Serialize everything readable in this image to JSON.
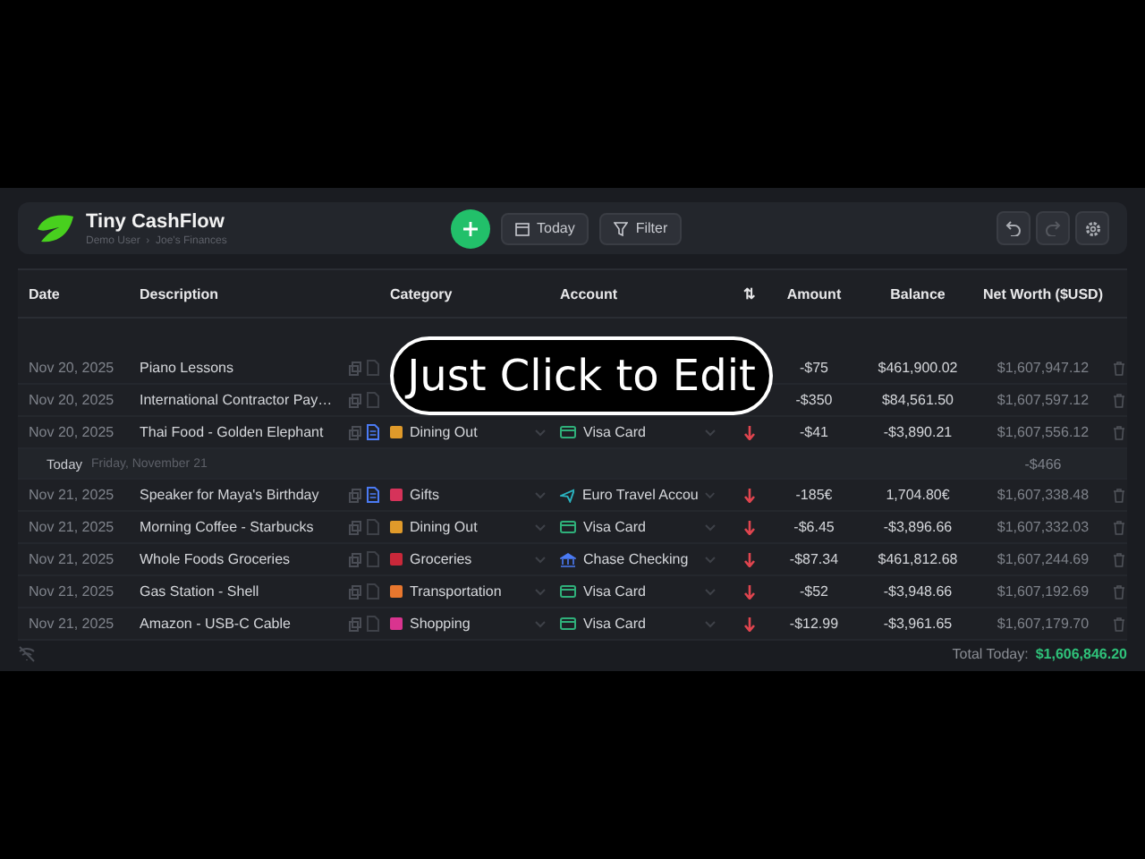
{
  "app": {
    "title": "Tiny CashFlow",
    "subtitle": "Demo User  ›  Joe's Finances"
  },
  "toolbar": {
    "buttons": [
      {
        "kind": "today",
        "label": "Today"
      },
      {
        "kind": "filter",
        "label": "Filter"
      }
    ]
  },
  "table": {
    "columns": [
      "Date",
      "Description",
      "Category",
      "Account",
      "⇅",
      "Amount",
      "Balance",
      "Net Worth ($USD)"
    ],
    "rows": [
      {
        "kind": "transaction",
        "date": "Nov 20, 2025",
        "description": "Piano Lessons",
        "has_note": false,
        "amount": "-$75",
        "balance": "$461,900.02",
        "net_worth": "$1,607,947.12"
      },
      {
        "kind": "transaction",
        "date": "Nov 20, 2025",
        "description": "International Contractor Pay…",
        "has_note": false,
        "amount": "-$350",
        "balance": "$84,561.50",
        "net_worth": "$1,607,597.12"
      },
      {
        "kind": "transaction",
        "date": "Nov 20, 2025",
        "description": "Thai Food - Golden Elephant",
        "has_note": true,
        "category": "Dining Out",
        "color": "#e09a2a",
        "account": {
          "kind": "card",
          "name": "Visa Card"
        },
        "amount": "-$41",
        "balance": "-$3,890.21",
        "net_worth": "$1,607,556.12"
      },
      {
        "kind": "group",
        "label": "Today",
        "date": "Friday, November 21",
        "total": "-$466"
      },
      {
        "kind": "transaction",
        "date": "Nov 21, 2025",
        "description": "Speaker for Maya's Birthday",
        "has_note": true,
        "category": "Gifts",
        "color": "#d6335a",
        "account": {
          "kind": "travel",
          "name": "Euro Travel Accou"
        },
        "amount": "-185€",
        "balance": "1,704.80€",
        "net_worth": "$1,607,338.48"
      },
      {
        "kind": "transaction",
        "date": "Nov 21, 2025",
        "description": "Morning Coffee - Starbucks",
        "has_note": false,
        "category": "Dining Out",
        "color": "#e09a2a",
        "account": {
          "kind": "card",
          "name": "Visa Card"
        },
        "amount": "-$6.45",
        "balance": "-$3,896.66",
        "net_worth": "$1,607,332.03"
      },
      {
        "kind": "transaction",
        "date": "Nov 21, 2025",
        "description": "Whole Foods Groceries",
        "has_note": false,
        "category": "Groceries",
        "color": "#c9283a",
        "account": {
          "kind": "bank",
          "name": "Chase Checking"
        },
        "amount": "-$87.34",
        "balance": "$461,812.68",
        "net_worth": "$1,607,244.69"
      },
      {
        "kind": "transaction",
        "date": "Nov 21, 2025",
        "description": "Gas Station - Shell",
        "has_note": false,
        "category": "Transportation",
        "color": "#e8772e",
        "account": {
          "kind": "card",
          "name": "Visa Card"
        },
        "amount": "-$52",
        "balance": "-$3,948.66",
        "net_worth": "$1,607,192.69"
      },
      {
        "kind": "transaction",
        "date": "Nov 21, 2025",
        "description": "Amazon - USB-C Cable",
        "has_note": false,
        "category": "Shopping",
        "color": "#d9348f",
        "account": {
          "kind": "card",
          "name": "Visa Card"
        },
        "amount": "-$12.99",
        "balance": "-$3,961.65",
        "net_worth": "$1,607,179.70"
      }
    ]
  },
  "footer": {
    "total_label": "Total Today:",
    "total_value": "$1,606,846.20"
  },
  "caption": "Just Click to Edit"
}
